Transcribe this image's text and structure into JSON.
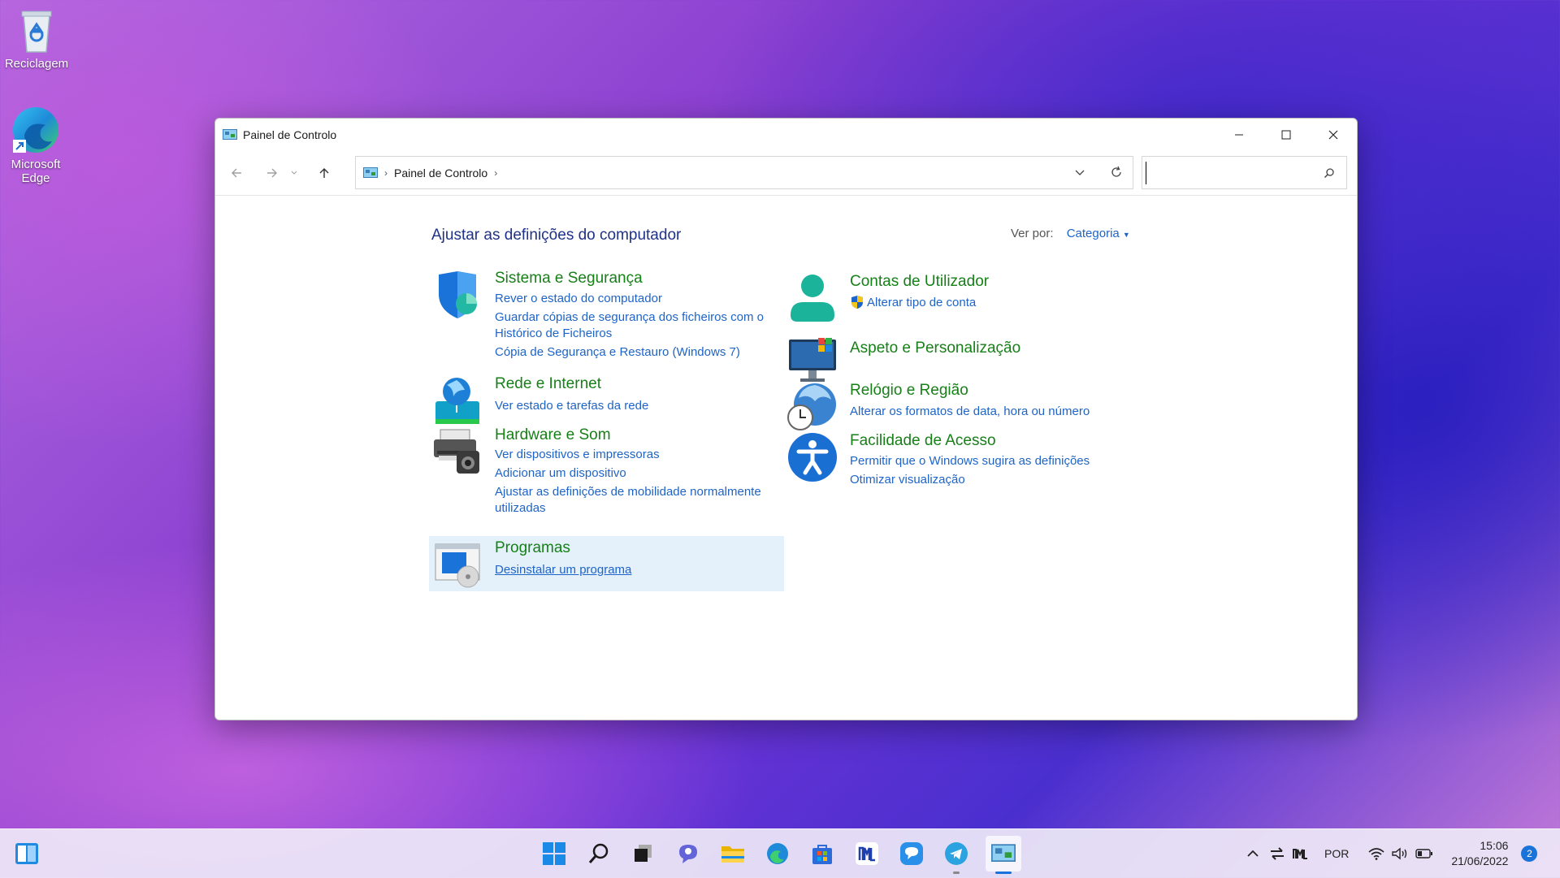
{
  "desktop": {
    "icons": [
      {
        "label": "Reciclagem"
      },
      {
        "label": "Microsoft Edge"
      }
    ]
  },
  "window": {
    "title": "Painel de Controlo",
    "address": {
      "crumb": "Painel de Controlo"
    },
    "search": {
      "placeholder": ""
    },
    "heading": "Ajustar as definições do computador",
    "view_by": {
      "label": "Ver por:",
      "value": "Categoria"
    },
    "categories": [
      {
        "title": "Sistema e Segurança",
        "links": [
          "Rever o estado do computador",
          "Guardar cópias de segurança dos ficheiros com o",
          "Histórico de Ficheiros",
          "Cópia de Segurança e Restauro (Windows 7)"
        ]
      },
      {
        "title": "Rede e Internet",
        "links": [
          "Ver estado e tarefas da rede"
        ]
      },
      {
        "title": "Hardware e Som",
        "links": [
          "Ver dispositivos e impressoras",
          "Adicionar um dispositivo",
          "Ajustar as definições de mobilidade normalmente",
          "utilizadas"
        ]
      },
      {
        "title": "Programas",
        "links": [
          "Desinstalar um programa"
        ]
      },
      {
        "title": "Contas de Utilizador",
        "links": [
          "Alterar tipo de conta"
        ]
      },
      {
        "title": "Aspeto e Personalização",
        "links": []
      },
      {
        "title": "Relógio e Região",
        "links": [
          "Alterar os formatos de data, hora ou número"
        ]
      },
      {
        "title": "Facilidade de Acesso",
        "links": [
          "Permitir que o Windows sugira as definições",
          "Otimizar visualização"
        ]
      }
    ]
  },
  "taskbar": {
    "apps": [
      "widgets-icon",
      "start-icon",
      "search-icon",
      "task-view-icon",
      "chat-icon",
      "file-explorer-icon",
      "edge-icon",
      "store-icon",
      "app-icon",
      "messenger-icon",
      "telegram-icon",
      "control-panel-icon"
    ],
    "tray": {
      "language": "POR",
      "time": "15:06",
      "date": "21/06/2022",
      "notifications": "2"
    }
  },
  "colors": {
    "link": "#1e64c8",
    "category_title": "#178018",
    "heading": "#1e3287",
    "highlight": "#e4f1fb"
  }
}
